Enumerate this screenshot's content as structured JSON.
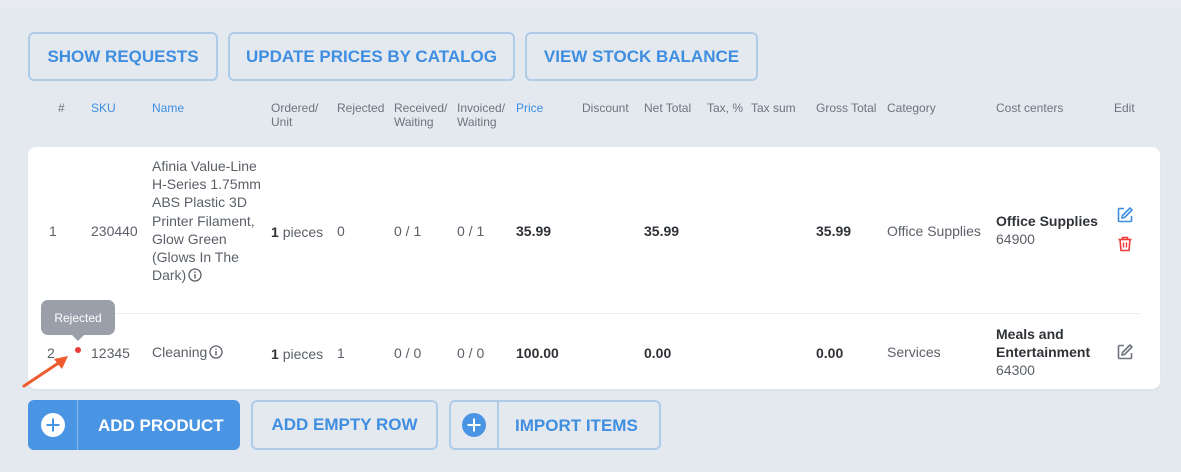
{
  "toolbar": {
    "show_requests": "SHOW REQUESTS",
    "update_prices": "UPDATE PRICES BY CATALOG",
    "view_stock": "VIEW STOCK BALANCE"
  },
  "columns": {
    "num": "#",
    "sku": "SKU",
    "name": "Name",
    "ordered_1": "Ordered/",
    "ordered_2": "Unit",
    "rejected": "Rejected",
    "received_1": "Received/",
    "received_2": "Waiting",
    "invoiced_1": "Invoiced/",
    "invoiced_2": "Waiting",
    "price": "Price",
    "discount": "Discount",
    "net_total": "Net Total",
    "tax_pct": "Tax, %",
    "tax_sum": "Tax sum",
    "gross_total": "Gross Total",
    "category": "Category",
    "cost_centers": "Cost centers",
    "edit": "Edit"
  },
  "rows": [
    {
      "num": "1",
      "sku": "230440",
      "name": "Afinia Value-Line H-Series 1.75mm ABS Plastic 3D Printer Filament, Glow Green (Glows In The Dark)",
      "qty": "1",
      "unit": "pieces",
      "rejected": "0",
      "received": "0 / 1",
      "invoiced": "0 / 1",
      "price": "35.99",
      "net_total": "35.99",
      "gross_total": "35.99",
      "category": "Office Supplies",
      "cost_center_name": "Office Supplies",
      "cost_center_code": "64900"
    },
    {
      "num": "2",
      "sku": "12345",
      "name": "Cleaning",
      "qty": "1",
      "unit": "pieces",
      "rejected": "1",
      "received": "0 / 0",
      "invoiced": "0 / 0",
      "price": "100.00",
      "net_total": "0.00",
      "gross_total": "0.00",
      "category": "Services",
      "cost_center_name_1": "Meals and",
      "cost_center_name_2": "Entertainment",
      "cost_center_code": "64300"
    }
  ],
  "tooltip": {
    "text": "Rejected"
  },
  "bottom": {
    "add_product": "ADD PRODUCT",
    "add_empty_row": "ADD EMPTY ROW",
    "import_items": "IMPORT ITEMS"
  },
  "colors": {
    "accent": "#3f8ee0",
    "primary_button": "#4a94e4",
    "delete": "#ee3b3b",
    "background": "#e4e9f0"
  },
  "icons": {
    "info": "info-icon",
    "edit": "edit-icon",
    "delete": "trash-icon",
    "add": "plus-circle-icon"
  }
}
